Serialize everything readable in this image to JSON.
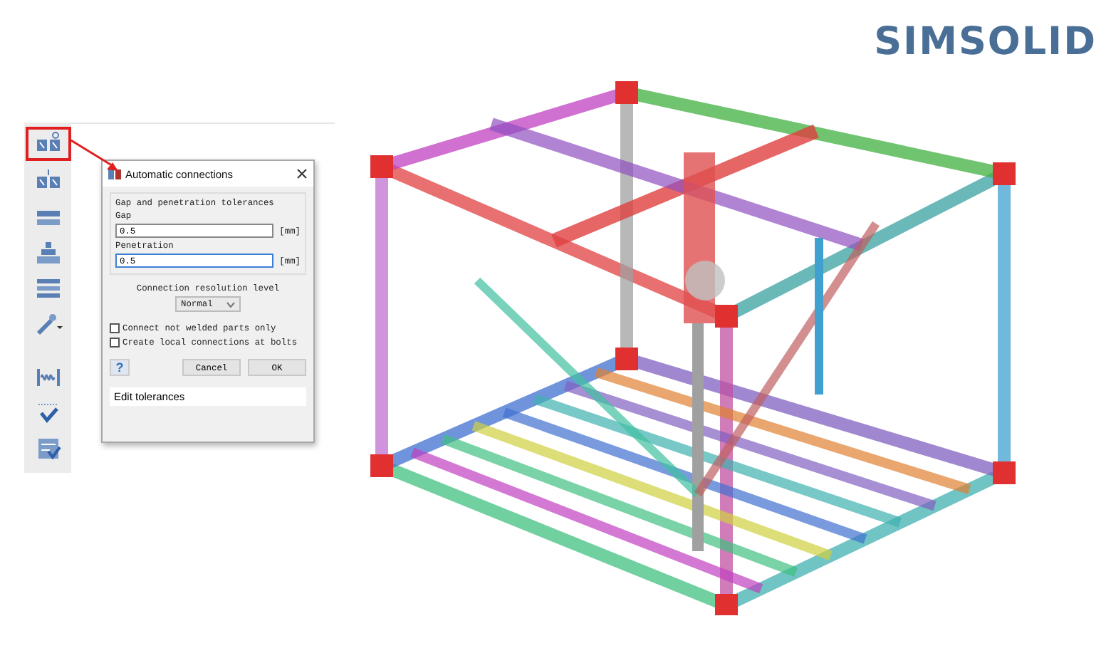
{
  "toolbar": {
    "items": [
      {
        "kind": "connect-a",
        "selected": true
      },
      {
        "kind": "connect-b",
        "selected": false
      },
      {
        "kind": "beam",
        "selected": false
      },
      {
        "kind": "stack",
        "selected": false
      },
      {
        "kind": "layers",
        "selected": false
      },
      {
        "kind": "wand",
        "selected": false
      },
      {
        "kind": "spring",
        "selected": false
      },
      {
        "kind": "check",
        "selected": false
      },
      {
        "kind": "filter",
        "selected": false
      }
    ]
  },
  "dialog": {
    "title": "Automatic connections",
    "group_title": "Gap and penetration tolerances",
    "fields": [
      {
        "label": "Gap",
        "value": "0.5",
        "unit": "[mm]",
        "focused": false
      },
      {
        "label": "Penetration",
        "value": "0.5",
        "unit": "[mm]",
        "focused": true
      }
    ],
    "resolution_label": "Connection resolution level",
    "resolution": {
      "value": "Normal"
    },
    "options": [
      {
        "label": "Connect not welded parts only",
        "checked": false
      },
      {
        "label": "Create local connections at bolts",
        "checked": false
      }
    ],
    "help_button": "?",
    "buttons": [
      "Cancel",
      "OK"
    ],
    "status": "Edit tolerances"
  },
  "logo": {
    "text": "SIMSOLID"
  }
}
